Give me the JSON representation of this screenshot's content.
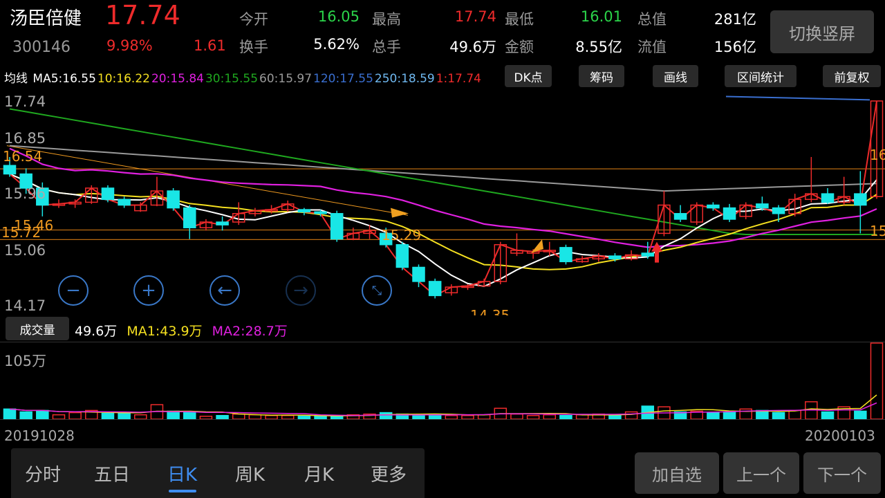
{
  "header": {
    "name": "汤臣倍健",
    "code": "300146",
    "price": "17.74",
    "change_pct": "9.98%",
    "change": "1.61",
    "switch_label": "切换竖屏"
  },
  "quotes": [
    {
      "label": "今开",
      "value": "16.05",
      "color": "#2bd44a"
    },
    {
      "label": "最高",
      "value": "17.74",
      "color": "#ee2b2b"
    },
    {
      "label": "最低",
      "value": "16.01",
      "color": "#2bd44a"
    },
    {
      "label": "总值",
      "value": "281亿",
      "color": "#ffffff"
    },
    {
      "label": "换手",
      "value": "5.62%",
      "color": "#ffffff"
    },
    {
      "label": "总手",
      "value": "49.6万",
      "color": "#ffffff"
    },
    {
      "label": "金额",
      "value": "8.55亿",
      "color": "#ffffff"
    },
    {
      "label": "流值",
      "value": "156亿",
      "color": "#ffffff"
    }
  ],
  "ma": {
    "label": "均线",
    "items": [
      {
        "text": "MA5:16.55",
        "color": "#ffffff"
      },
      {
        "text": "10:16.22",
        "color": "#f5e020"
      },
      {
        "text": "20:15.84",
        "color": "#e020e0"
      },
      {
        "text": "30:15.55",
        "color": "#1fa81f"
      },
      {
        "text": "60:15.97",
        "color": "#9a9a9a"
      },
      {
        "text": "120:17.55",
        "color": "#3a6fd0"
      },
      {
        "text": "250:18.59",
        "color": "#6fb8f0"
      },
      {
        "text": "1:17.74",
        "color": "#ee2b2b"
      }
    ]
  },
  "tools": [
    "DK点",
    "筹码",
    "画线",
    "区间统计",
    "前复权"
  ],
  "y_axis": [
    "17.74",
    "16.85",
    "15.96",
    "15.06",
    "14.17"
  ],
  "chart_labels": {
    "low_mark": "14.35",
    "left_level_1": "16.54",
    "left_level_2": "15.46",
    "left_level_3": "15.72",
    "mid_level": "15.29",
    "right_level_1": "16",
    "right_level_2": "15"
  },
  "volume": {
    "button": "成交量",
    "value": "49.6万",
    "ma1": "MA1:43.9万",
    "ma2": "MA2:28.7万",
    "axis_max": "105万",
    "colors": {
      "ma1": "#f5e020",
      "ma2": "#e020e0"
    }
  },
  "dates": {
    "start": "20191028",
    "end": "20200103"
  },
  "tabs": [
    "分时",
    "五日",
    "日K",
    "周K",
    "月K",
    "更多"
  ],
  "active_tab": "日K",
  "nav": {
    "add": "加自选",
    "prev": "上一个",
    "next": "下一个"
  },
  "chart_data": {
    "type": "candlestick",
    "ylim": [
      14.17,
      17.74
    ],
    "up_color": "#ee2b2b",
    "down_color": "#19e6e6",
    "candles": [
      [
        16.6,
        16.45,
        16.75,
        16.4
      ],
      [
        16.45,
        16.2,
        16.55,
        16.1
      ],
      [
        16.2,
        15.9,
        16.3,
        15.7
      ],
      [
        15.9,
        15.92,
        16.0,
        15.85
      ],
      [
        15.92,
        15.95,
        16.0,
        15.85
      ],
      [
        15.95,
        16.2,
        16.25,
        15.92
      ],
      [
        16.2,
        16.0,
        16.25,
        15.95
      ],
      [
        16.0,
        15.9,
        16.05,
        15.85
      ],
      [
        15.8,
        15.9,
        15.95,
        15.78
      ],
      [
        15.9,
        16.15,
        16.4,
        15.88
      ],
      [
        16.15,
        15.85,
        16.2,
        15.8
      ],
      [
        15.85,
        15.5,
        15.9,
        15.3
      ],
      [
        15.5,
        15.6,
        15.65,
        15.45
      ],
      [
        15.6,
        15.55,
        15.7,
        15.45
      ],
      [
        15.6,
        15.75,
        15.95,
        15.55
      ],
      [
        15.75,
        15.8,
        15.85,
        15.7
      ],
      [
        15.8,
        15.82,
        15.9,
        15.75
      ],
      [
        15.82,
        15.92,
        15.98,
        15.78
      ],
      [
        15.82,
        15.78,
        15.85,
        15.72
      ],
      [
        15.78,
        15.75,
        15.82,
        15.7
      ],
      [
        15.75,
        15.3,
        15.8,
        15.25
      ],
      [
        15.3,
        15.4,
        15.5,
        15.28
      ],
      [
        15.4,
        15.45,
        15.55,
        15.3
      ],
      [
        15.4,
        15.2,
        15.5,
        15.15
      ],
      [
        15.2,
        14.8,
        15.25,
        14.75
      ],
      [
        14.8,
        14.55,
        14.85,
        14.45
      ],
      [
        14.55,
        14.3,
        14.6,
        14.25
      ],
      [
        14.35,
        14.45,
        14.5,
        14.3
      ],
      [
        14.45,
        14.47,
        14.5,
        14.4
      ],
      [
        14.47,
        14.55,
        14.6,
        14.45
      ],
      [
        14.55,
        15.2,
        15.25,
        14.5
      ],
      [
        15.05,
        15.1,
        15.4,
        15.0
      ],
      [
        15.05,
        15.08,
        15.12,
        14.95
      ],
      [
        15.08,
        15.1,
        15.25,
        15.0
      ],
      [
        15.15,
        14.9,
        15.2,
        14.85
      ],
      [
        14.9,
        14.95,
        15.0,
        14.88
      ],
      [
        14.95,
        15.0,
        15.05,
        14.9
      ],
      [
        15.0,
        14.95,
        15.05,
        14.9
      ],
      [
        14.95,
        15.02,
        15.1,
        14.92
      ],
      [
        15.05,
        15.0,
        15.25,
        14.95
      ],
      [
        15.4,
        15.9,
        16.15,
        15.35
      ],
      [
        15.75,
        15.65,
        15.9,
        15.6
      ],
      [
        15.6,
        15.9,
        15.95,
        15.55
      ],
      [
        15.9,
        15.85,
        15.95,
        15.8
      ],
      [
        15.85,
        15.65,
        15.92,
        15.6
      ],
      [
        15.7,
        15.9,
        15.95,
        15.65
      ],
      [
        15.92,
        15.85,
        16.05,
        15.8
      ],
      [
        15.85,
        15.75,
        15.9,
        15.6
      ],
      [
        15.75,
        16.0,
        16.1,
        15.7
      ],
      [
        16.0,
        16.1,
        16.75,
        15.95
      ],
      [
        16.1,
        15.95,
        16.2,
        15.92
      ],
      [
        15.95,
        16.05,
        16.4,
        15.9
      ],
      [
        16.1,
        15.9,
        16.5,
        15.4
      ],
      [
        16.05,
        17.74,
        17.74,
        16.01
      ]
    ],
    "volumes": [
      14,
      10,
      12,
      6,
      9,
      12,
      8,
      9,
      6,
      20,
      11,
      9,
      4,
      5,
      7,
      6,
      5,
      5,
      4,
      4,
      5,
      6,
      7,
      9,
      7,
      6,
      7,
      5,
      5,
      6,
      15,
      7,
      5,
      6,
      5,
      6,
      7,
      5,
      10,
      18,
      17,
      10,
      11,
      9,
      10,
      14,
      12,
      9,
      12,
      24,
      10,
      17,
      11,
      105
    ]
  }
}
